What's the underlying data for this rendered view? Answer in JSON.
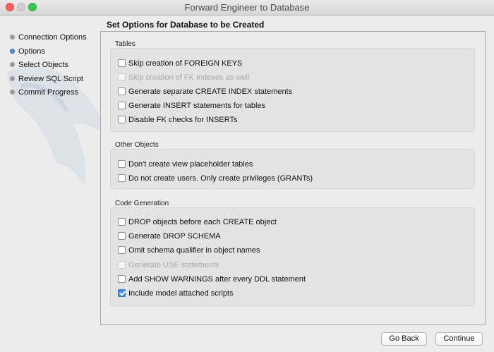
{
  "window": {
    "title": "Forward Engineer to Database"
  },
  "sidebar": {
    "steps": [
      {
        "label": "Connection Options",
        "state": "done"
      },
      {
        "label": "Options",
        "state": "current"
      },
      {
        "label": "Select Objects",
        "state": "pending"
      },
      {
        "label": "Review SQL Script",
        "state": "pending"
      },
      {
        "label": "Commit Progress",
        "state": "pending"
      }
    ]
  },
  "main": {
    "heading": "Set Options for Database to be Created",
    "groups": [
      {
        "title": "Tables",
        "options": [
          {
            "label": "Skip creation of FOREIGN KEYS",
            "checked": false,
            "enabled": true
          },
          {
            "label": "Skip creation of FK Indexes as well",
            "checked": false,
            "enabled": false
          },
          {
            "label": "Generate separate CREATE INDEX statements",
            "checked": false,
            "enabled": true
          },
          {
            "label": "Generate INSERT statements for tables",
            "checked": false,
            "enabled": true
          },
          {
            "label": "Disable FK checks for INSERTs",
            "checked": false,
            "enabled": true
          }
        ]
      },
      {
        "title": "Other Objects",
        "options": [
          {
            "label": "Don't create view placeholder tables",
            "checked": false,
            "enabled": true
          },
          {
            "label": "Do not create users. Only create privileges (GRANTs)",
            "checked": false,
            "enabled": true
          }
        ]
      },
      {
        "title": "Code Generation",
        "options": [
          {
            "label": "DROP objects before each CREATE object",
            "checked": false,
            "enabled": true
          },
          {
            "label": "Generate DROP SCHEMA",
            "checked": false,
            "enabled": true
          },
          {
            "label": "Omit schema qualifier in object names",
            "checked": false,
            "enabled": true
          },
          {
            "label": "Generate USE statements",
            "checked": false,
            "enabled": false
          },
          {
            "label": "Add SHOW WARNINGS after every DDL statement",
            "checked": false,
            "enabled": true
          },
          {
            "label": "Include model attached scripts",
            "checked": true,
            "enabled": true
          }
        ]
      }
    ]
  },
  "footer": {
    "back_label": "Go Back",
    "continue_label": "Continue"
  },
  "colors": {
    "accent": "#3b8ef0",
    "current_step": "#5b8fc9"
  }
}
